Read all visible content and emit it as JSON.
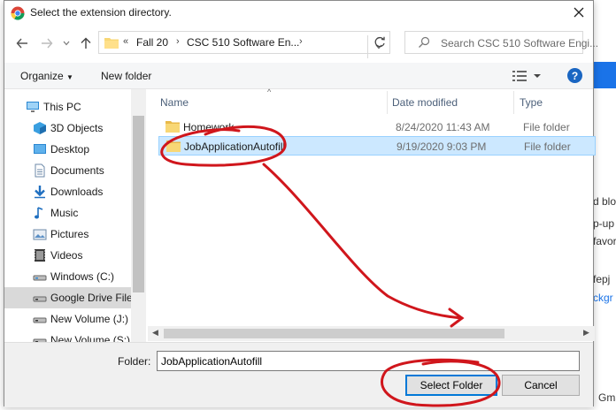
{
  "window": {
    "title": "Select the extension directory."
  },
  "address_bar": {
    "crumbs": [
      "Fall 20",
      "CSC 510 Software En..."
    ],
    "prefix": "«"
  },
  "search": {
    "placeholder": "Search CSC 510 Software Engi..."
  },
  "toolbar": {
    "organize_label": "Organize",
    "new_folder_label": "New folder"
  },
  "sidebar": {
    "items": [
      {
        "label": "This PC",
        "icon": "pc-icon"
      },
      {
        "label": "3D Objects",
        "icon": "cube-icon"
      },
      {
        "label": "Desktop",
        "icon": "desktop-icon"
      },
      {
        "label": "Documents",
        "icon": "document-icon"
      },
      {
        "label": "Downloads",
        "icon": "download-icon"
      },
      {
        "label": "Music",
        "icon": "music-icon"
      },
      {
        "label": "Pictures",
        "icon": "pictures-icon"
      },
      {
        "label": "Videos",
        "icon": "video-icon"
      },
      {
        "label": "Windows (C:)",
        "icon": "drive-icon"
      },
      {
        "label": "Google Drive File",
        "icon": "drive-icon"
      },
      {
        "label": "New Volume (J:)",
        "icon": "drive-icon"
      },
      {
        "label": "New Volume (S:)",
        "icon": "drive-icon"
      }
    ]
  },
  "files": {
    "columns": [
      "Name",
      "Date modified",
      "Type"
    ],
    "rows": [
      {
        "name": "Homework",
        "date": "8/24/2020 11:43 AM",
        "type": "File folder"
      },
      {
        "name": "JobApplicationAutofill",
        "date": "9/19/2020 9:03 PM",
        "type": "File folder"
      }
    ]
  },
  "footer": {
    "folder_label": "Folder:",
    "folder_value": "JobApplicationAutofill",
    "select_label": "Select Folder",
    "cancel_label": "Cancel"
  },
  "background": {
    "lines": [
      "d blo",
      "p-up",
      "favor",
      "fepj",
      "ckgr",
      "Gma"
    ]
  },
  "colors": {
    "selection": "#cce8ff",
    "accent": "#0078d7",
    "annotation": "#d0161c",
    "folder": "#f8d775"
  }
}
